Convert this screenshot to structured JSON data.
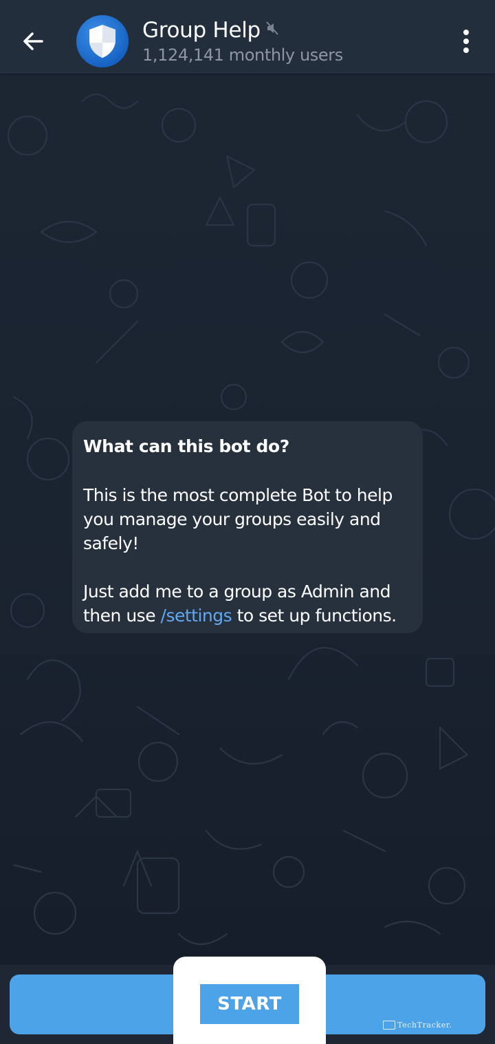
{
  "header": {
    "title": "Group Help",
    "subtitle": "1,124,141 monthly users"
  },
  "bot_info": {
    "heading": "What can this bot do?",
    "paragraph1": "This is the most complete Bot to help you manage your groups easily and safely!",
    "paragraph2_before": "Just add me to a group as Admin and then use ",
    "paragraph2_link": "/settings",
    "paragraph2_after": " to set up functions."
  },
  "bottom": {
    "start_label": "START"
  },
  "watermark": {
    "text": "TechTracker."
  },
  "colors": {
    "header_bg": "#232e3c",
    "chat_bg": "#1b2430",
    "bubble_bg": "#27313e",
    "link": "#61a8f0",
    "accent": "#4da3e8"
  },
  "icons": {
    "back": "arrow-left-icon",
    "avatar": "shield-icon",
    "mute": "muted-speaker-icon",
    "menu": "more-vertical-icon"
  }
}
